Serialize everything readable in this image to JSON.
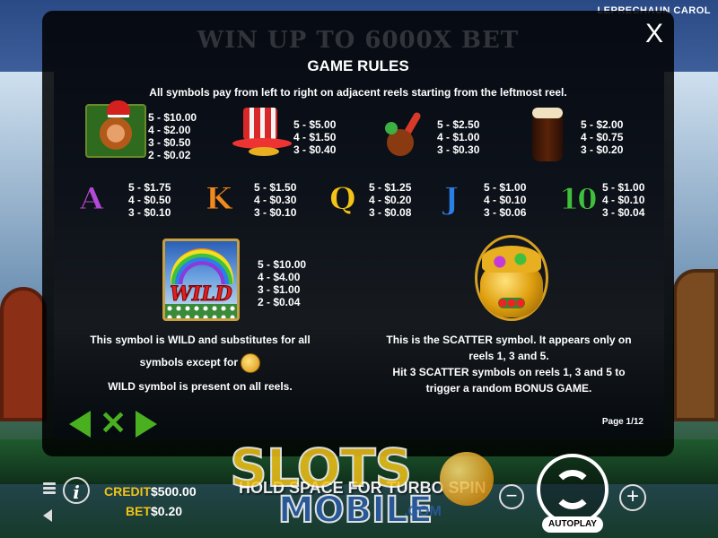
{
  "game": {
    "name": "LEPRECHAUN CAROL"
  },
  "panel": {
    "banner": "WIN UP TO 6000X BET",
    "title": "GAME RULES",
    "intro": "All symbols pay from left to right on adjacent reels starting from the leftmost reel.",
    "close": "X",
    "page": "Page 1/12"
  },
  "paytable": [
    {
      "symbol": "leprechaun-icon",
      "pays": [
        "5 - $10.00",
        "4 - $2.00",
        "3 - $0.50",
        "2 - $0.02"
      ]
    },
    {
      "symbol": "top-hat-icon",
      "pays": [
        "5 - $5.00",
        "4 - $1.50",
        "3 - $0.40"
      ]
    },
    {
      "symbol": "pipe-icon",
      "pays": [
        "5 - $2.50",
        "4 - $1.00",
        "3 - $0.30"
      ]
    },
    {
      "symbol": "beer-icon",
      "pays": [
        "5 - $2.00",
        "4 - $0.75",
        "3 - $0.20"
      ]
    },
    {
      "symbol": "letter-a-icon",
      "glyph": "A",
      "pays": [
        "5 - $1.75",
        "4 - $0.50",
        "3 - $0.10"
      ]
    },
    {
      "symbol": "letter-k-icon",
      "glyph": "K",
      "pays": [
        "5 - $1.50",
        "4 - $0.30",
        "3 - $0.10"
      ]
    },
    {
      "symbol": "letter-q-icon",
      "glyph": "Q",
      "pays": [
        "5 - $1.25",
        "4 - $0.20",
        "3 - $0.08"
      ]
    },
    {
      "symbol": "letter-j-icon",
      "glyph": "J",
      "pays": [
        "5 - $1.00",
        "4 - $0.10",
        "3 - $0.06"
      ]
    },
    {
      "symbol": "ten-icon",
      "glyph": "10",
      "pays": [
        "5 - $1.00",
        "4 - $0.10",
        "3 - $0.04"
      ]
    }
  ],
  "wild": {
    "label": "WILD",
    "pays": [
      "5 - $10.00",
      "4 - $4.00",
      "3 - $1.00",
      "2 - $0.04"
    ],
    "desc1": "This symbol is WILD and substitutes for all",
    "desc2": "symbols except for",
    "desc3": "WILD symbol is present on all reels."
  },
  "scatter": {
    "desc1": "This is the SCATTER symbol. It appears only on",
    "desc2": "reels 1, 3 and 5.",
    "desc3": "Hit 3 SCATTER symbols on reels 1, 3 and 5 to",
    "desc4": "trigger a random BONUS GAME."
  },
  "hud": {
    "credit_label": "CREDIT",
    "credit_value": "$500.00",
    "bet_label": "BET",
    "bet_value": "$0.20",
    "hold_text": "HOLD SPACE FOR TURBO SPIN",
    "autoplay": "AUTOPLAY",
    "minus": "−",
    "plus": "+"
  },
  "watermark": {
    "line1": "SLOTS",
    "line2": "MOBILE",
    "line3": ".COM"
  },
  "colors": {
    "nav_green": "#4ab020",
    "gold": "#f2c318"
  }
}
